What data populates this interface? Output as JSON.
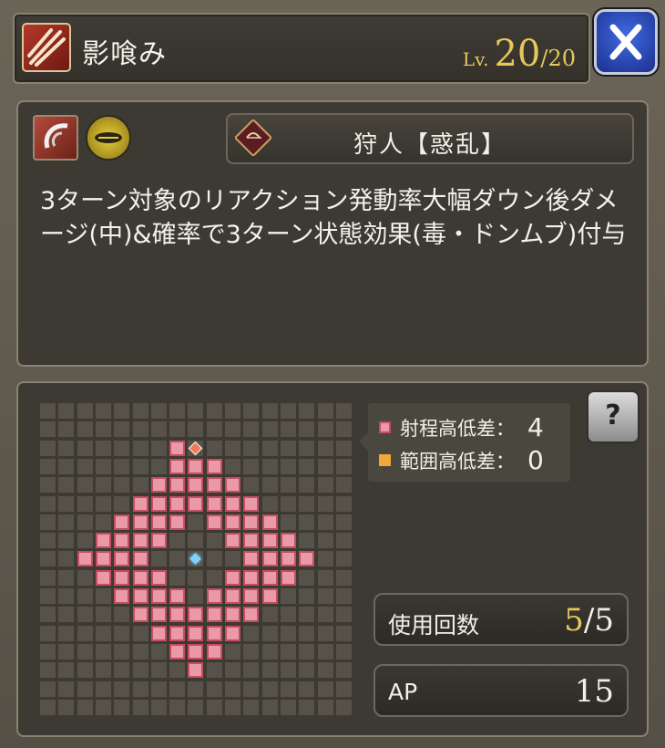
{
  "header": {
    "title": "影喰み",
    "level_label": "Lv.",
    "level_current": "20",
    "level_separator": "/",
    "level_max": "20",
    "close_symbol": "✕"
  },
  "skill": {
    "element_icons": [
      "slash-element-icon",
      "thunder-element-icon"
    ],
    "job_name": "狩人【惑乱】",
    "description": "3ターン対象のリアクション発動率大幅ダウン後ダメージ(中)&確率で3ターン状態効果(毒・ドンムブ)付与"
  },
  "range": {
    "legend": {
      "range_label": "射程高低差：",
      "range_value": "4",
      "aoe_label": "範囲高低差：",
      "aoe_value": "0"
    },
    "help_symbol": "?",
    "grid_size": 17,
    "range_cells_rows": [
      [
        7,
        2
      ],
      [
        7,
        3
      ],
      [
        8,
        3
      ],
      [
        9,
        3
      ],
      [
        6,
        4
      ],
      [
        7,
        4
      ],
      [
        8,
        4
      ],
      [
        9,
        4
      ],
      [
        10,
        4
      ],
      [
        5,
        5
      ],
      [
        6,
        5
      ],
      [
        7,
        5
      ],
      [
        8,
        5
      ],
      [
        9,
        5
      ],
      [
        10,
        5
      ],
      [
        11,
        5
      ],
      [
        4,
        6
      ],
      [
        5,
        6
      ],
      [
        6,
        6
      ],
      [
        7,
        6
      ],
      [
        9,
        6
      ],
      [
        10,
        6
      ],
      [
        11,
        6
      ],
      [
        12,
        6
      ],
      [
        3,
        7
      ],
      [
        4,
        7
      ],
      [
        5,
        7
      ],
      [
        6,
        7
      ],
      [
        10,
        7
      ],
      [
        11,
        7
      ],
      [
        12,
        7
      ],
      [
        13,
        7
      ],
      [
        2,
        8
      ],
      [
        3,
        8
      ],
      [
        4,
        8
      ],
      [
        5,
        8
      ],
      [
        11,
        8
      ],
      [
        12,
        8
      ],
      [
        13,
        8
      ],
      [
        14,
        8
      ],
      [
        3,
        9
      ],
      [
        4,
        9
      ],
      [
        5,
        9
      ],
      [
        6,
        9
      ],
      [
        10,
        9
      ],
      [
        11,
        9
      ],
      [
        12,
        9
      ],
      [
        13,
        9
      ],
      [
        4,
        10
      ],
      [
        5,
        10
      ],
      [
        6,
        10
      ],
      [
        7,
        10
      ],
      [
        9,
        10
      ],
      [
        10,
        10
      ],
      [
        11,
        10
      ],
      [
        12,
        10
      ],
      [
        5,
        11
      ],
      [
        6,
        11
      ],
      [
        7,
        11
      ],
      [
        8,
        11
      ],
      [
        9,
        11
      ],
      [
        10,
        11
      ],
      [
        11,
        11
      ],
      [
        6,
        12
      ],
      [
        7,
        12
      ],
      [
        8,
        12
      ],
      [
        9,
        12
      ],
      [
        10,
        12
      ],
      [
        7,
        13
      ],
      [
        8,
        13
      ],
      [
        9,
        13
      ],
      [
        8,
        14
      ]
    ],
    "top_marker_cell": [
      8,
      2
    ],
    "center_cell": [
      8,
      8
    ]
  },
  "stats": {
    "uses_label": "使用回数",
    "uses_current": "5",
    "uses_separator": "/",
    "uses_max": "5",
    "ap_label": "AP",
    "ap_value": "15"
  },
  "colors": {
    "accent_gold": "#e8c75a",
    "range_cell": "#e99aa6",
    "aoe_cell": "#f0a938",
    "close_blue": "#2c4bd0"
  }
}
